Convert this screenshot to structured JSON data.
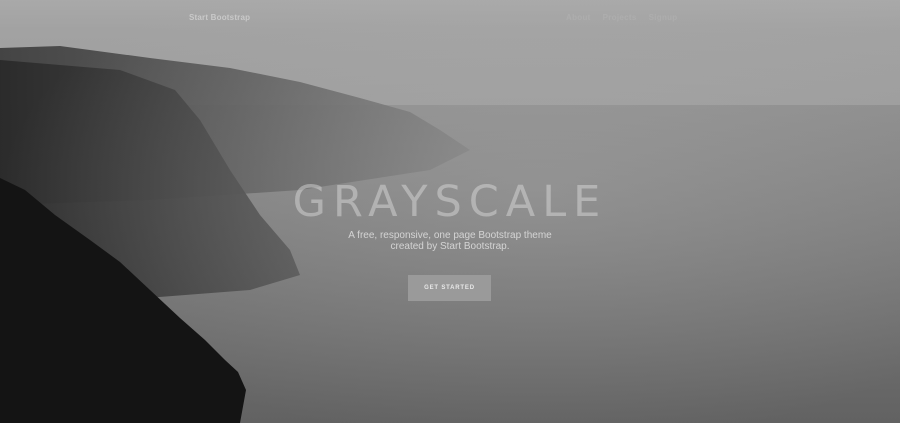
{
  "navbar": {
    "brand": "Start Bootstrap",
    "links": [
      "About",
      "Projects",
      "Signup"
    ]
  },
  "masthead": {
    "title": "GRAYSCALE",
    "subtitle_line1": "A free, responsive, one page Bootstrap theme",
    "subtitle_line2": "created by Start Bootstrap.",
    "button_label": "GET STARTED"
  },
  "colors": {
    "sky": "#a6a6a6",
    "sea": "#7a7a7a",
    "cliff_dark": "#141414",
    "button": "#9a9a9a"
  }
}
